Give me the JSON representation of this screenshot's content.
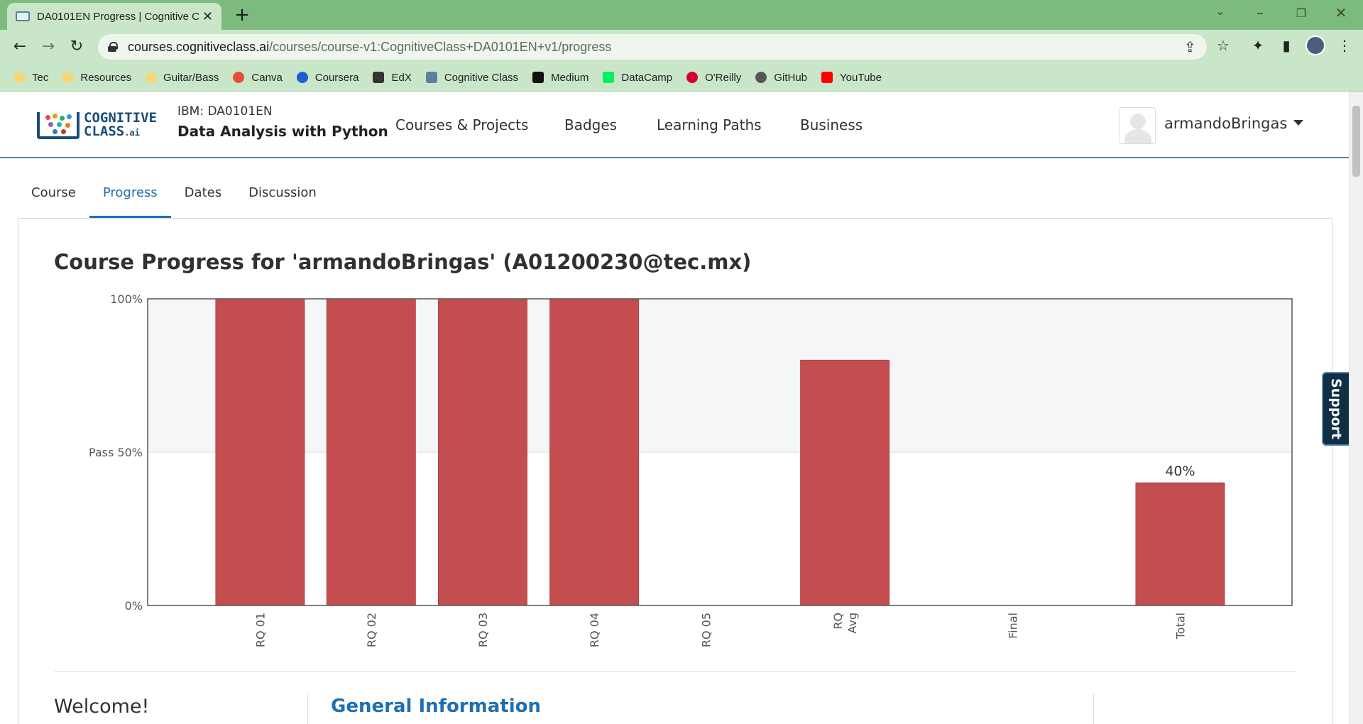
{
  "browser": {
    "tab_title": "DA0101EN Progress | Cognitive Class",
    "new_tab": "+",
    "url_host": "courses.cognitiveclass.ai",
    "url_path": "/courses/course-v1:CognitiveClass+DA0101EN+v1/progress",
    "bookmarks": [
      "Tec",
      "Resources",
      "Guitar/Bass",
      "Canva",
      "Coursera",
      "EdX",
      "Cognitive Class",
      "Medium",
      "DataCamp",
      "O'Reilly",
      "GitHub",
      "YouTube"
    ],
    "bookmark_colors": {
      "Canva": "#e74c3c",
      "Coursera": "#1f5fd1",
      "EdX": "#333333",
      "Cognitive Class": "#5a7fa3",
      "Medium": "#111111",
      "DataCamp": "#03ef62",
      "O'Reilly": "#d3002d",
      "GitHub": "#555555",
      "YouTube": "#ff0000"
    }
  },
  "header": {
    "course_id": "IBM: DA0101EN",
    "course_name": "Data Analysis with Python",
    "nav": [
      "Courses & Projects",
      "Badges",
      "Learning Paths",
      "Business"
    ],
    "username": "armandoBringas",
    "logo_text_1": "COGNITIVE",
    "logo_text_2": "CLASS",
    "logo_text_3": ".ai"
  },
  "tabs": [
    {
      "label": "Course",
      "active": false
    },
    {
      "label": "Progress",
      "active": true
    },
    {
      "label": "Dates",
      "active": false
    },
    {
      "label": "Discussion",
      "active": false
    }
  ],
  "page": {
    "title": "Course Progress for 'armandoBringas' (A01200230@tec.mx)",
    "welcome": "Welcome!",
    "general_info": "General Information",
    "support": "Support"
  },
  "chart_data": {
    "type": "bar",
    "categories": [
      "RQ 01",
      "RQ 02",
      "RQ 03",
      "RQ 04",
      "RQ 05",
      "RQ Avg",
      "Final",
      "Total"
    ],
    "values": [
      100,
      100,
      100,
      100,
      0,
      80,
      0,
      40
    ],
    "value_labels": {
      "Total": "40%"
    },
    "yticks": [
      {
        "value": 0,
        "label": "0%"
      },
      {
        "value": 50,
        "label": "Pass 50%"
      },
      {
        "value": 100,
        "label": "100%"
      }
    ],
    "ylim": [
      0,
      100
    ],
    "bar_color": "#c44e4f",
    "pass_band_color": "#f5f6f7"
  }
}
